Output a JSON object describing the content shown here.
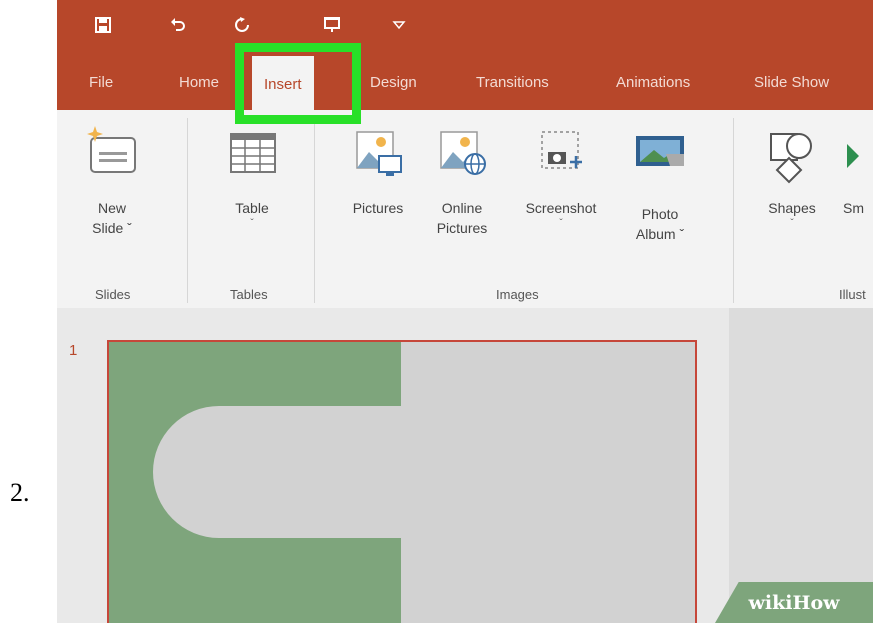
{
  "step": {
    "number": "2."
  },
  "quick_access": {
    "icons": [
      "save-icon",
      "undo-icon",
      "redo-icon",
      "present-icon",
      "customize-dropdown-icon"
    ]
  },
  "tabs": [
    {
      "label": "File"
    },
    {
      "label": "Home"
    },
    {
      "label": "Insert",
      "active": true
    },
    {
      "label": "Design"
    },
    {
      "label": "Transitions"
    },
    {
      "label": "Animations"
    },
    {
      "label": "Slide Show"
    }
  ],
  "ribbon": {
    "new_slide": {
      "line1": "New",
      "line2": "Slide ˇ"
    },
    "table": {
      "label": "Table",
      "caret": "ˇ"
    },
    "pictures": {
      "label": "Pictures"
    },
    "online_pictures": {
      "line1": "Online",
      "line2": "Pictures"
    },
    "screenshot": {
      "label": "Screenshot",
      "caret": "ˇ"
    },
    "photo_album": {
      "line1": "Photo",
      "line2": "Album ˇ"
    },
    "shapes": {
      "label": "Shapes",
      "caret": "ˇ"
    },
    "smartart": {
      "label": "Sm"
    },
    "groups": {
      "slides": "Slides",
      "tables": "Tables",
      "images": "Images",
      "illustrations": "Illust"
    }
  },
  "slides_pane": {
    "slide_number": "1"
  },
  "watermark": {
    "text": "wikiHow"
  },
  "colors": {
    "accent": "#b7472a",
    "highlight": "#28e028",
    "slide_green": "#7ea57c"
  }
}
